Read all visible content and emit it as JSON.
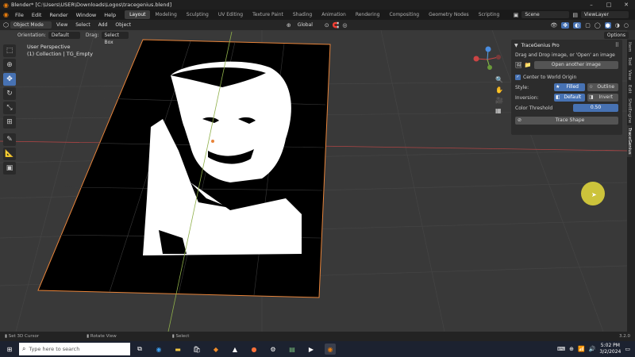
{
  "window": {
    "title": "Blender* [C:\\Users\\USER\\Downloads\\Logos\\tracegenius.blend]"
  },
  "menu": [
    "File",
    "Edit",
    "Render",
    "Window",
    "Help"
  ],
  "workspace_tabs": [
    "Layout",
    "Modeling",
    "Sculpting",
    "UV Editing",
    "Texture Paint",
    "Shading",
    "Animation",
    "Rendering",
    "Compositing",
    "Geometry Nodes",
    "Scripting"
  ],
  "scene": {
    "label": "Scene",
    "view_layer": "ViewLayer"
  },
  "header": {
    "mode": "Object Mode",
    "view": "View",
    "select": "Select",
    "add": "Add",
    "object": "Object",
    "transform": "Global",
    "options": "Options"
  },
  "subheader": {
    "orientation_label": "Orientation:",
    "orientation_value": "Default",
    "drag_label": "Drag:",
    "drag_value": "Select Box"
  },
  "viewport": {
    "perspective": "User Perspective",
    "collection": "(1) Collection | TG_Empty"
  },
  "panel": {
    "title": "TraceGenius Pro",
    "hint": "Drag and Drop image, or 'Open' an image",
    "open_btn": "Open another image",
    "center_label": "Center to World Origin",
    "style_label": "Style:",
    "style_filled": "Filled",
    "style_outline": "Outline",
    "inversion_label": "Inversion:",
    "inv_default": "Default",
    "inv_invert": "Invert",
    "threshold_label": "Color Threshold",
    "threshold_value": "0.50",
    "trace_btn": "Trace Shape"
  },
  "side_tabs": [
    "Item",
    "Tool",
    "View",
    "Edit",
    "ShotEngine",
    "TraceGenius"
  ],
  "statusbar": {
    "left": "Set 3D Cursor",
    "mid": "Rotate View",
    "right": "Select",
    "version": "3.2.0"
  },
  "taskbar": {
    "search": "Type here to search",
    "time": "5:02 PM",
    "date": "3/2/2024"
  },
  "colors": {
    "accent": "#4772b3",
    "selection_outline": "#e8843a"
  }
}
